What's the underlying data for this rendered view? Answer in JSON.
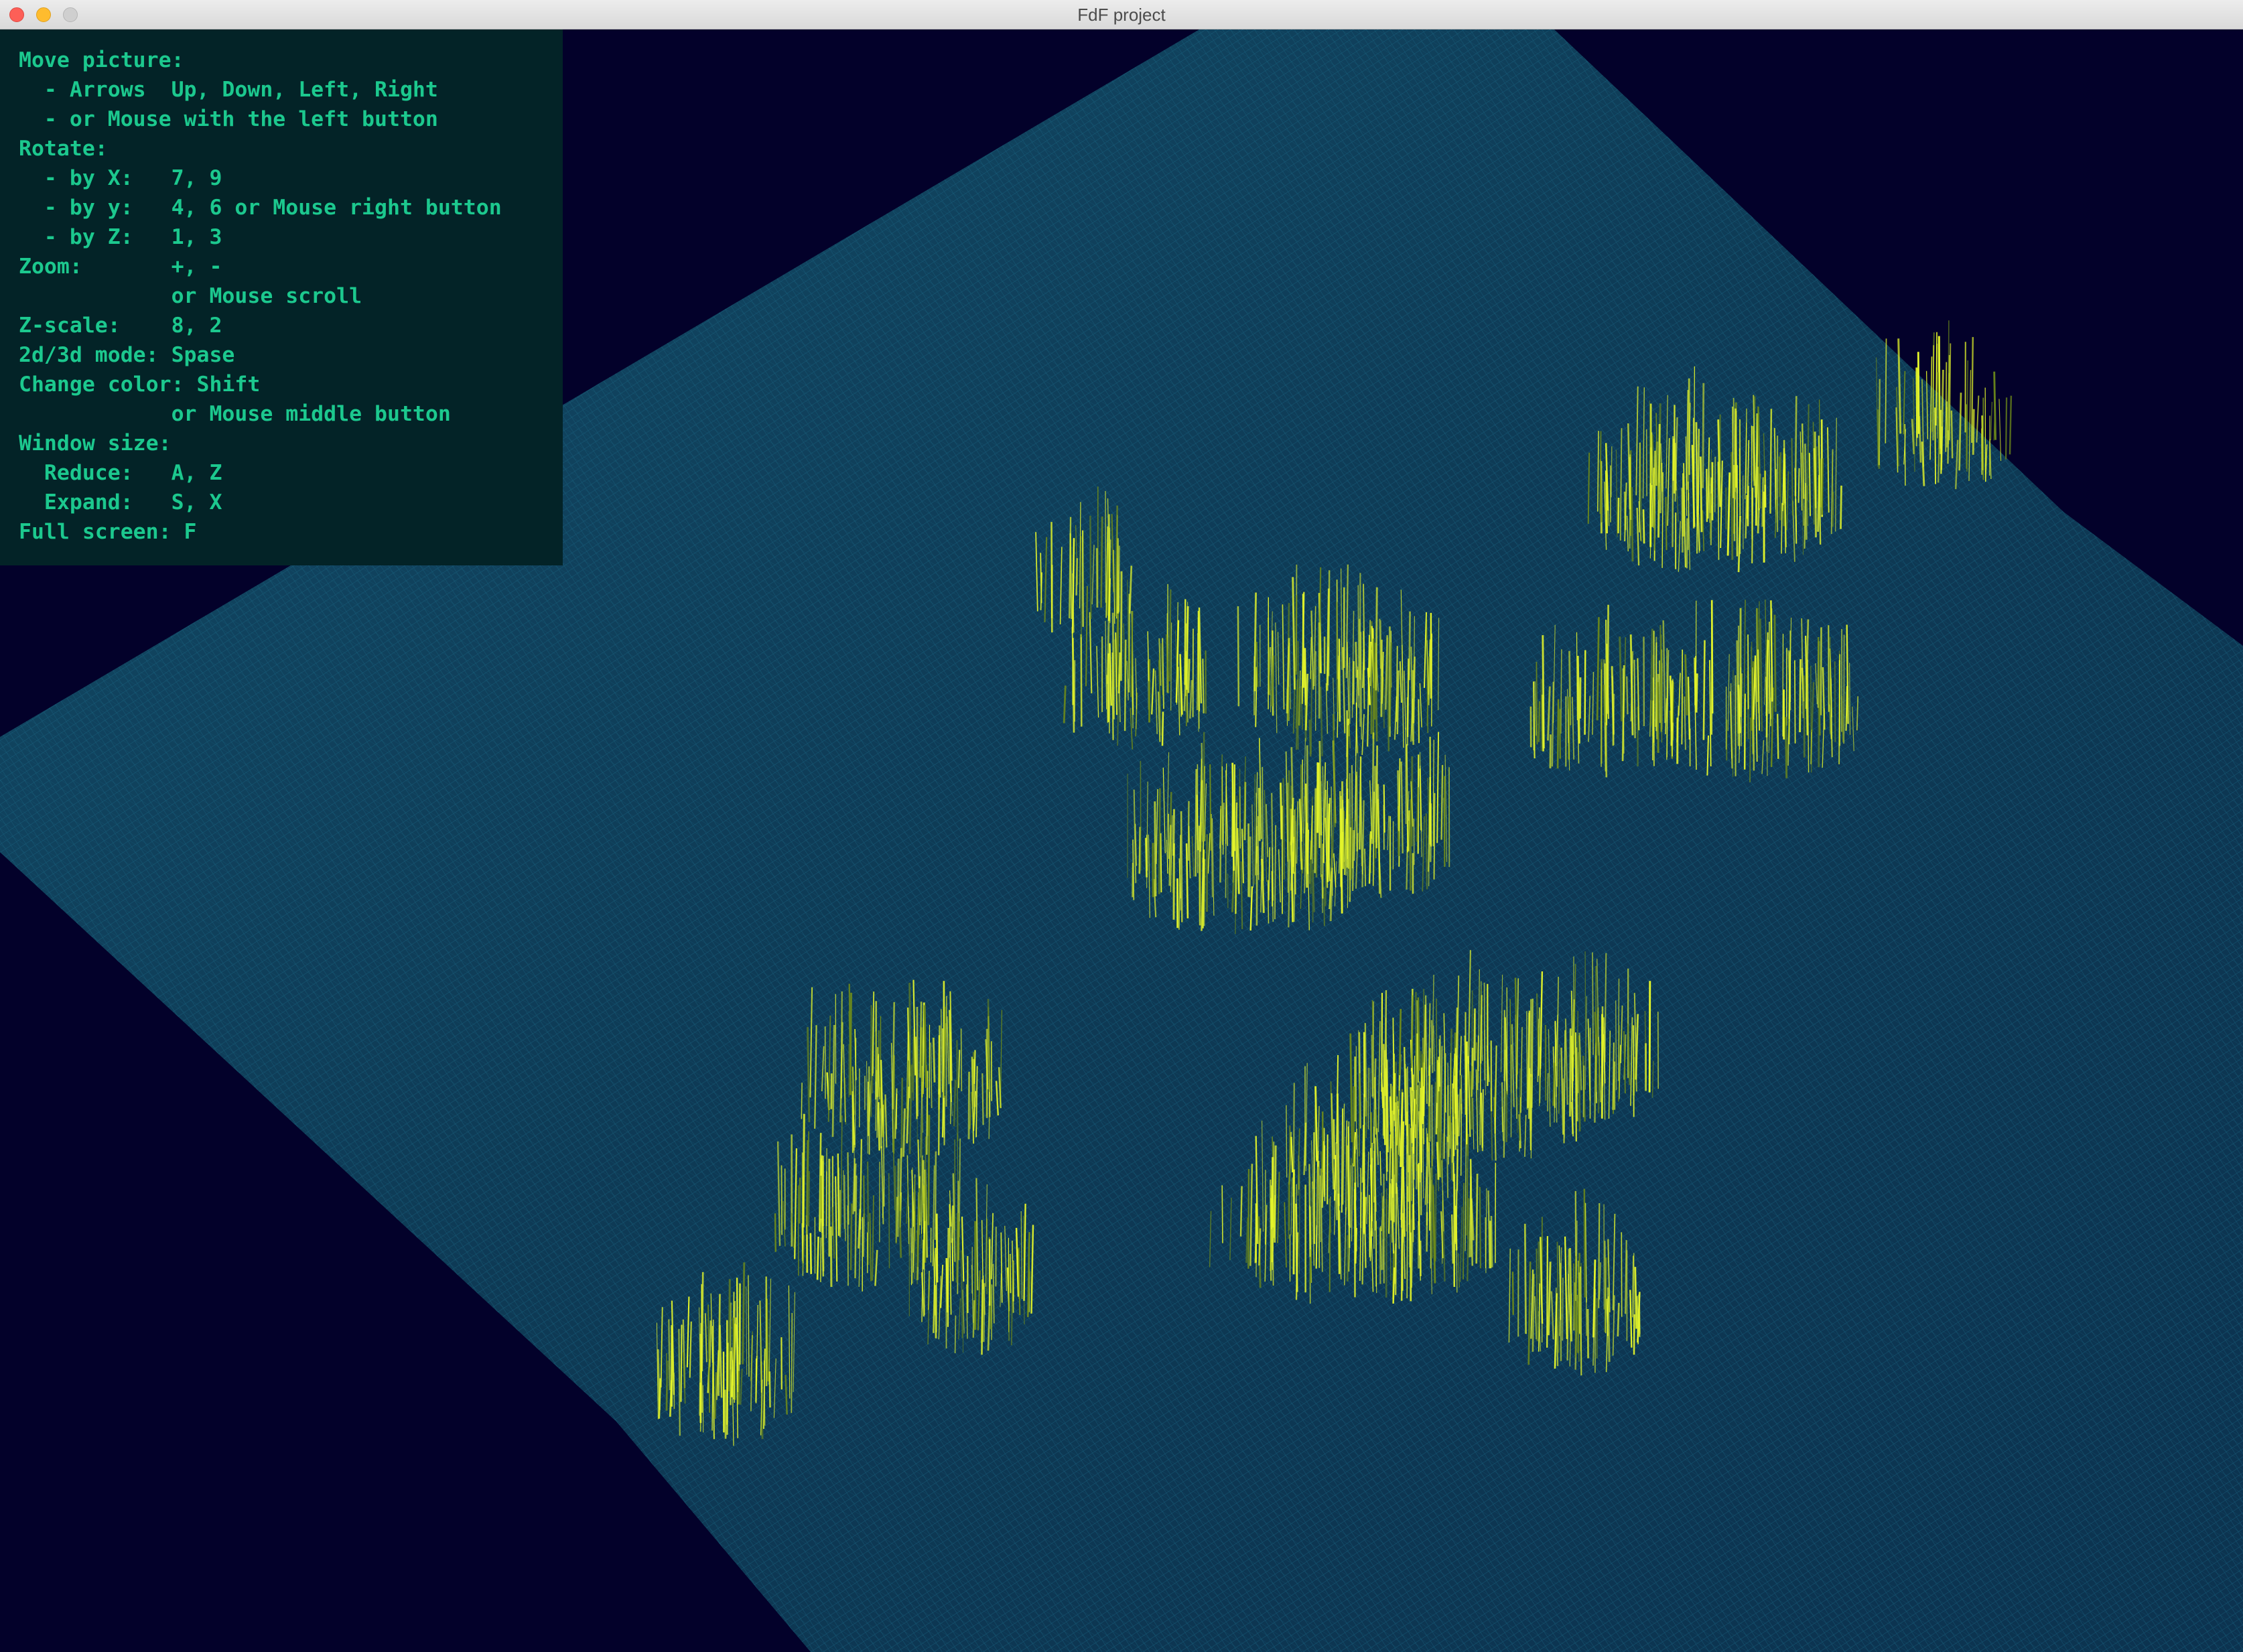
{
  "window": {
    "title": "FdF project",
    "background_color": "#03012a"
  },
  "help": {
    "text_color": "#1cc88e",
    "background_color": "#032327",
    "lines": [
      "Move picture:",
      "  - Arrows  Up, Down, Left, Right",
      "  - or Mouse with the left button",
      "Rotate:",
      "  - by X:   7, 9",
      "  - by y:   4, 6 or Mouse right button",
      "  - by Z:   1, 3",
      "Zoom:       +, -",
      "            or Mouse scroll",
      "Z-scale:    8, 2",
      "2d/3d mode: Spase",
      "Change color: Shift",
      "            or Mouse middle button",
      "Window size:",
      "  Reduce:   A, Z",
      "  Expand:   S, X",
      "Full screen: F"
    ]
  },
  "render": {
    "plane_color": "#0f3d5a",
    "low_color": "#1a5a6e",
    "peak_color": "#e4f52a",
    "peak_shadow_color": "#6d8a1a"
  }
}
